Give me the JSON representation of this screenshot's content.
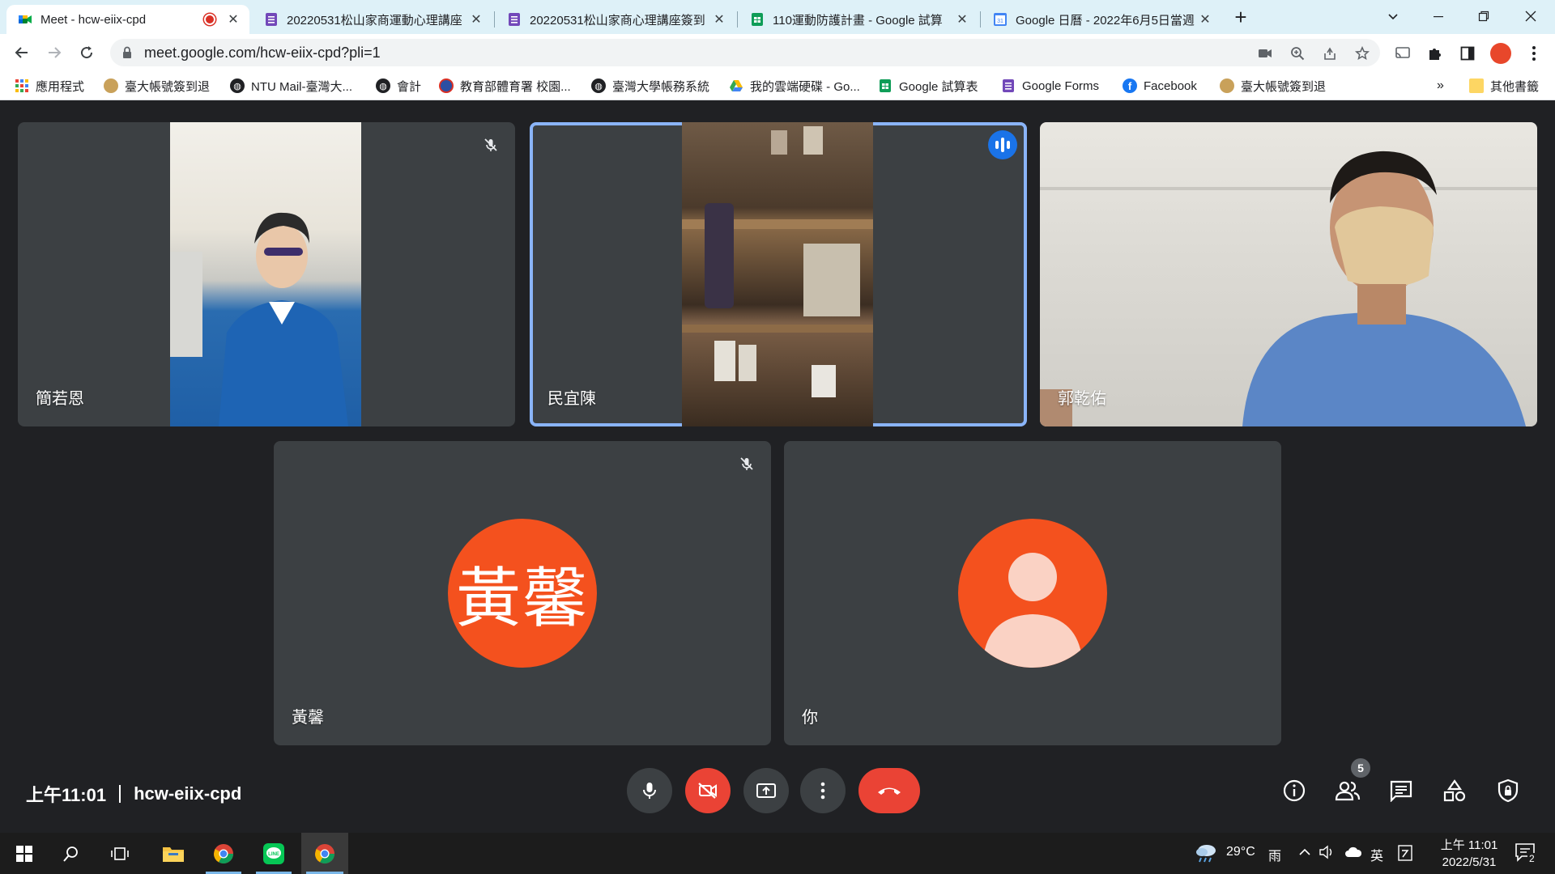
{
  "browser": {
    "tabs": [
      {
        "title": "Meet - hcw-eiix-cpd",
        "favicon": "google-meet-icon",
        "recording": true
      },
      {
        "title": "20220531松山家商運動心理講座",
        "favicon": "google-forms-icon"
      },
      {
        "title": "20220531松山家商心理講座簽到",
        "favicon": "google-forms-icon"
      },
      {
        "title": "110運動防護計畫 - Google 試算",
        "favicon": "google-sheets-icon"
      },
      {
        "title": "Google 日曆 - 2022年6月5日當週",
        "favicon": "google-calendar-icon"
      }
    ],
    "new_tab_label": "+",
    "url": "meet.google.com/hcw-eiix-cpd?pli=1"
  },
  "bookmarks": {
    "items": [
      {
        "label": "應用程式",
        "icon": "apps-grid-icon"
      },
      {
        "label": "臺大帳號簽到退",
        "icon": "ntu-seal-icon"
      },
      {
        "label": "NTU Mail-臺灣大...",
        "icon": "globe-icon"
      },
      {
        "label": "會計",
        "icon": "globe-icon"
      },
      {
        "label": "教育部體育署 校園...",
        "icon": "moe-sports-icon"
      },
      {
        "label": "臺灣大學帳務系統",
        "icon": "globe-icon"
      },
      {
        "label": "我的雲端硬碟 - Go...",
        "icon": "google-drive-icon"
      },
      {
        "label": "Google 試算表",
        "icon": "google-sheets-icon"
      },
      {
        "label": "Google Forms",
        "icon": "google-forms-icon"
      },
      {
        "label": "Facebook",
        "icon": "facebook-icon"
      },
      {
        "label": "臺大帳號簽到退",
        "icon": "ntu-seal-icon"
      }
    ],
    "overflow_label": "»",
    "other_bookmarks": "其他書籤"
  },
  "meet": {
    "participants": [
      {
        "name": "簡若恩",
        "video": true,
        "muted": true
      },
      {
        "name": "民宜陳",
        "video": true,
        "muted": false,
        "speaking": true
      },
      {
        "name": "郭乾佑",
        "video": true,
        "muted": false
      },
      {
        "name": "黃馨",
        "video": false,
        "muted": true,
        "initials": "黃馨"
      },
      {
        "name": "你",
        "video": false,
        "muted": false
      }
    ],
    "time": "上午11:01",
    "meeting_code": "hcw-eiix-cpd",
    "people_count": "5",
    "colors": {
      "accent": "#8ab4f8",
      "danger": "#ea4335",
      "avatar": "#f4511e",
      "tile": "#3c4043",
      "background": "#202124"
    }
  },
  "taskbar": {
    "weather_temp": "29°C",
    "weather_desc": "雨",
    "ime": "英",
    "clock_time": "上午 11:01",
    "clock_date": "2022/5/31",
    "notification_count": "2"
  }
}
